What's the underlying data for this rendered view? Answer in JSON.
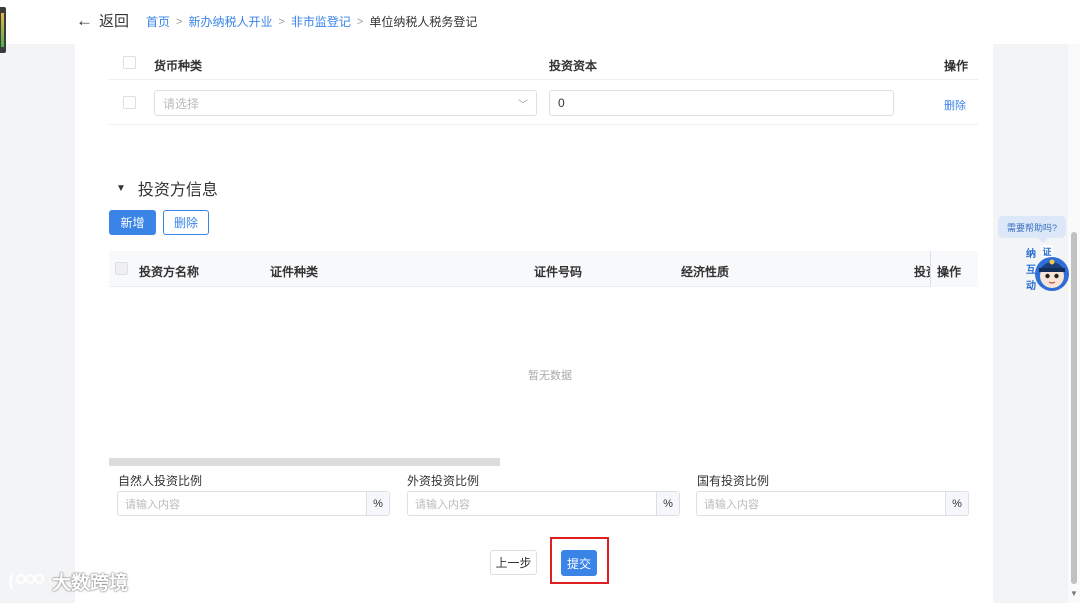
{
  "header": {
    "back_label": "返回",
    "breadcrumb": [
      "首页",
      "新办纳税人开业",
      "非市监登记",
      "单位纳税人税务登记"
    ]
  },
  "currency_table": {
    "columns": [
      "货币种类",
      "投资资本",
      "操作"
    ],
    "rows": [
      {
        "currency_placeholder": "请选择",
        "capital": "0",
        "action": "删除"
      }
    ]
  },
  "investor_section": {
    "title": "投资方信息",
    "add_button": "新增",
    "delete_button": "删除",
    "columns": [
      "投资方名称",
      "证件种类",
      "证件号码",
      "经济性质",
      "投资",
      "操作"
    ],
    "empty_text": "暂无数据"
  },
  "ratios": [
    {
      "label": "自然人投资比例",
      "placeholder": "请输入内容",
      "unit": "%"
    },
    {
      "label": "外资投资比例",
      "placeholder": "请输入内容",
      "unit": "%"
    },
    {
      "label": "国有投资比例",
      "placeholder": "请输入内容",
      "unit": "%"
    }
  ],
  "footer": {
    "prev_button": "上一步",
    "submit_button": "提交"
  },
  "help": {
    "bubble": "需要帮助吗?",
    "mascot_text": [
      "纳",
      "互",
      "动"
    ],
    "mascot_badge": "证"
  },
  "watermark": {
    "text": "大数跨境"
  },
  "colors": {
    "primary": "#3a84e8",
    "highlight": "#e02020"
  }
}
